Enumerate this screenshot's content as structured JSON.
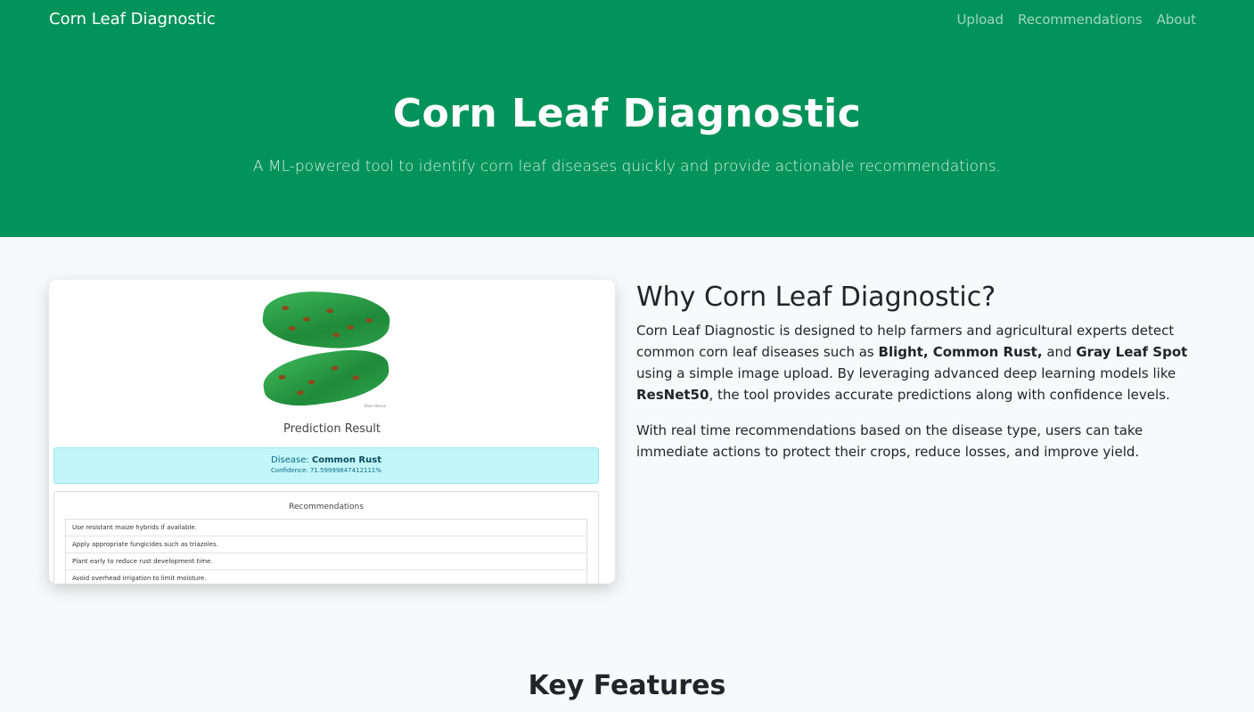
{
  "nav": {
    "brand": "Corn Leaf Diagnostic",
    "links": [
      "Upload",
      "Recommendations",
      "About"
    ]
  },
  "hero": {
    "title": "Corn Leaf Diagnostic",
    "subtitle": "A ML-powered tool to identify corn leaf diseases quickly and provide actionable recommendations."
  },
  "preview": {
    "leaf_credit": "Eben Hanna",
    "prediction_title": "Prediction Result",
    "disease_label": "Disease:",
    "disease_value": "Common Rust",
    "confidence": "Confidence: 71.59999847412111%",
    "recommendations_title": "Recommendations",
    "recommendations": [
      "Use resistant maize hybrids if available.",
      "Apply appropriate fungicides such as triazoles.",
      "Plant early to reduce rust development time.",
      "Avoid overhead irrigation to limit moisture."
    ]
  },
  "about": {
    "title": "Why Corn Leaf Diagnostic?",
    "p1_a": "Corn Leaf Diagnostic is designed to help farmers and agricultural experts detect common corn leaf diseases such as ",
    "p1_b1": "Blight, Common Rust,",
    "p1_c": " and ",
    "p1_b2": "Gray Leaf Spot",
    "p1_d": " using a simple image upload. By leveraging advanced deep learning models like ",
    "p1_b3": "ResNet50",
    "p1_e": ", the tool provides accurate predictions along with confidence levels.",
    "p2": "With real time recommendations based on the disease type, users can take immediate actions to protect their crops, reduce losses, and improve yield."
  },
  "features": {
    "title": "Key Features"
  },
  "colors": {
    "primary": "#02935a",
    "info_bg": "#c3f6fb"
  }
}
